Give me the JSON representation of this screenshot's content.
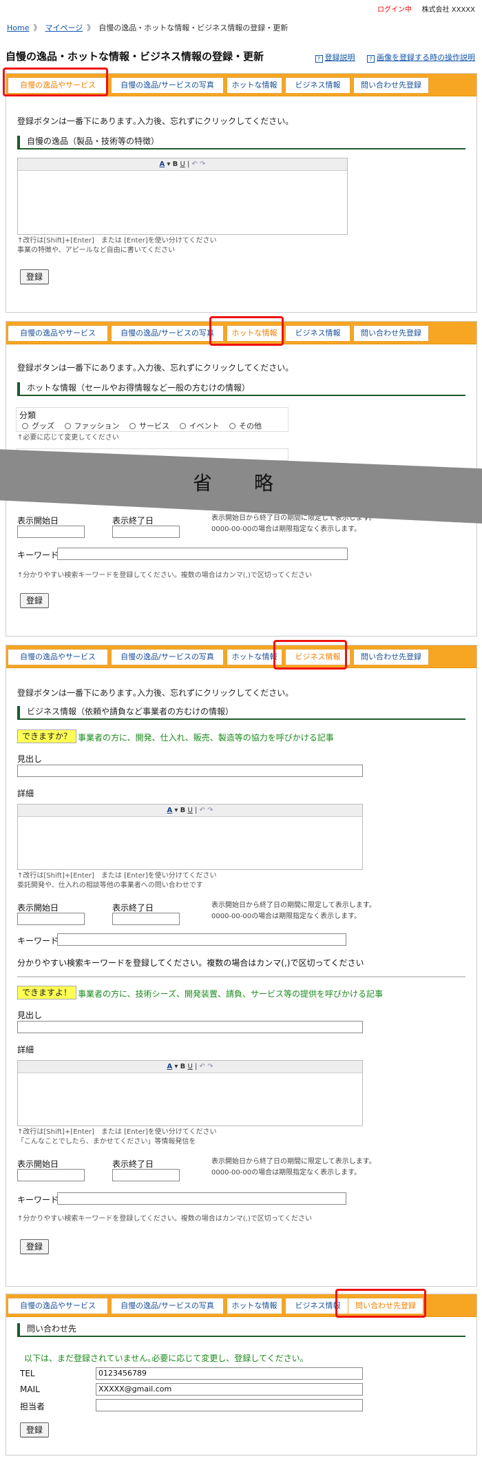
{
  "header": {
    "login_status": "ログイン中",
    "company": "株式会社 XXXXX"
  },
  "breadcrumb": {
    "home": "Home",
    "mypage": "マイページ",
    "current": "自慢の逸品・ホットな情報・ビジネス情報の登録・更新"
  },
  "page_title": "自慢の逸品・ホットな情報・ビジネス情報の登録・更新",
  "help_links": {
    "registration_help": "登録説明",
    "image_help": "画像を登録する時の操作説明"
  },
  "tabs": [
    "自慢の逸品やサービス",
    "自慢の逸品/サービスの写真",
    "ホットな情報",
    "ビジネス情報",
    "問い合わせ先登録"
  ],
  "common": {
    "hint": "登録ボタンは一番下にあります｡入力後、忘れずにクリックしてください｡",
    "newline_note": "↑改行は[Shift]+[Enter]　または [Enter]を使い分けてください",
    "register_button": "登録",
    "start_date": "表示開始日",
    "end_date": "表示終了日",
    "keyword": "キーワード",
    "date_note1": "表示開始日から終了日の期間に限定して表示します。",
    "date_note2": "0000-00-00の場合は期限指定なく表示します。",
    "keyword_note_small": "↑分かりやすい検索キーワードを登録してください。複数の場合はカンマ(,)で区切ってください",
    "keyword_note_large": "分かりやすい検索キーワードを登録してください。複数の場合はカンマ(,)で区切ってください",
    "editor_toolbar": {
      "color": "A",
      "bold": "B",
      "underline": "U",
      "undo": "↶",
      "redo": "↷"
    }
  },
  "section1": {
    "heading": "自慢の逸品（製品・技術等の特徴）",
    "note2": "事業の特徴や、アピールなど自由に書いてください"
  },
  "section2": {
    "heading": "ホットな情報（セールやお得情報など一般の方むけの情報）",
    "category_label": "分類",
    "categories": [
      "グッズ",
      "ファッション",
      "サービス",
      "イベント",
      "その他"
    ],
    "category_note": "↑必要に応じて変更してください",
    "omitted": "省 略",
    "date_note1": "表示開始日から終了日の期間に限定して表示します。"
  },
  "section3": {
    "heading": "ビジネス情報（依頼や請負など事業者の方むけの情報）",
    "can_you_badge": "できますか？",
    "can_you_text": "事業者の方に、開発、仕入れ、販売、製造等の協力を呼びかける記事",
    "title_label": "見出し",
    "detail_label": "詳細",
    "can_you_note": "委託開発や、仕入れの相談等他の事業者への問い合わせです",
    "we_can_badge": "できますよ！",
    "we_can_text": "事業者の方に、技術シーズ、開発装置、請負、サービス等の提供を呼びかける記事",
    "we_can_note": "「こんなことでしたら、まかせてください」等情報発信を"
  },
  "section4": {
    "heading": "問い合わせ先",
    "notice": "以下は、まだ登録されていません｡必要に応じて変更し、登録してください。",
    "tel_label": "TEL",
    "tel_value": "0123456789",
    "mail_label": "MAIL",
    "mail_value": "XXXXX@gmail.com",
    "person_label": "担当者",
    "person_value": ""
  },
  "colors": {
    "tab_bar": "#f6a623",
    "highlight": "#ee1111",
    "link": "#1155aa",
    "heading_line": "#1d5a2a",
    "badge": "#ffff55",
    "green_text": "#1a8a1a"
  }
}
